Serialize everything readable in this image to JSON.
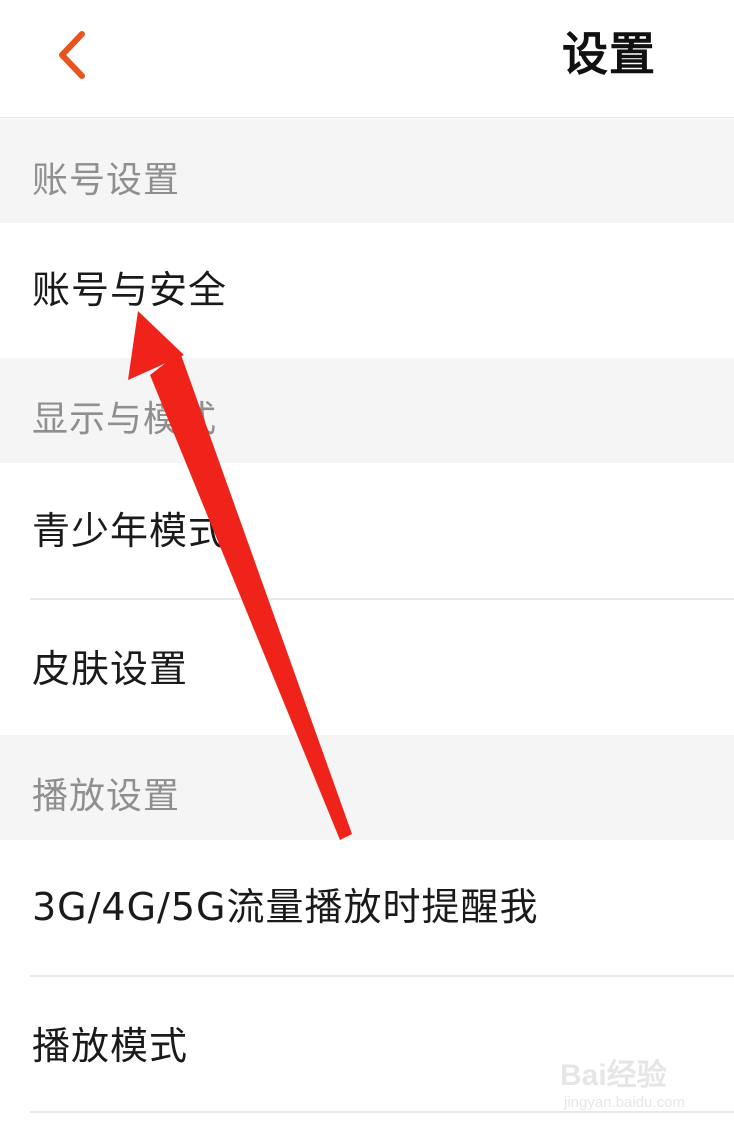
{
  "header": {
    "title": "设置",
    "back_icon": "chevron-left-icon",
    "accent_color": "#e8541e"
  },
  "sections": [
    {
      "title": "账号设置",
      "items": [
        "账号与安全"
      ]
    },
    {
      "title": "显示与模式",
      "items": [
        "青少年模式",
        "皮肤设置"
      ]
    },
    {
      "title": "播放设置",
      "items": [
        "3G/4G/5G流量播放时提醒我",
        "播放模式"
      ]
    }
  ],
  "annotation": {
    "color": "#f0231b",
    "icon": "red-arrow-pointer"
  },
  "watermark": {
    "brand": "Bai经验",
    "url": "jingyan.baidu.com"
  }
}
